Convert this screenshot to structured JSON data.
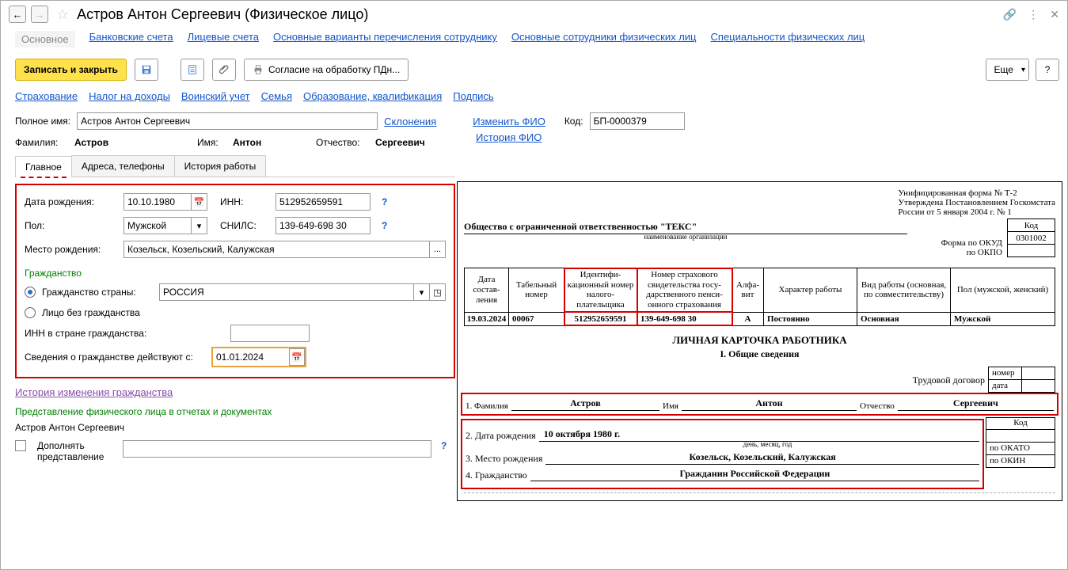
{
  "title": "Астров Антон Сергеевич (Физическое лицо)",
  "nav": {
    "main": "Основное",
    "bank": "Банковские счета",
    "personal": "Лицевые счета",
    "transfer": "Основные варианты перечисления сотруднику",
    "employees": "Основные сотрудники физических лиц",
    "spec": "Специальности физических лиц"
  },
  "toolbar": {
    "save_close": "Записать и закрыть",
    "consent": "Согласие на обработку ПДн...",
    "more": "Еще"
  },
  "sublinks": {
    "insurance": "Страхование",
    "tax": "Налог на доходы",
    "military": "Воинский учет",
    "family": "Семья",
    "edu": "Образование, квалификация",
    "sign": "Подпись"
  },
  "fio": {
    "full_label": "Полное имя:",
    "full_value": "Астров Антон Сергеевич",
    "decl": "Склонения",
    "change": "Изменить ФИО",
    "history": "История ФИО",
    "code_label": "Код:",
    "code_value": "БП-0000379",
    "last_label": "Фамилия:",
    "last": "Астров",
    "first_label": "Имя:",
    "first": "Антон",
    "mid_label": "Отчество:",
    "mid": "Сергеевич"
  },
  "tabs": {
    "main": "Главное",
    "addr": "Адреса, телефоны",
    "work": "История работы"
  },
  "form": {
    "dob_label": "Дата рождения:",
    "dob": "10.10.1980",
    "inn_label": "ИНН:",
    "inn": "512952659591",
    "sex_label": "Пол:",
    "sex": "Мужской",
    "snils_label": "СНИЛС:",
    "snils": "139-649-698 30",
    "pob_label": "Место рождения:",
    "pob": "Козельск, Козельский, Калужская",
    "citizenship_head": "Гражданство",
    "citizenship_country_label": "Гражданство страны:",
    "citizenship_country": "РОССИЯ",
    "stateless_label": "Лицо без гражданства",
    "foreign_inn_label": "ИНН в стране гражданства:",
    "since_label": "Сведения о гражданстве действуют с:",
    "since": "01.01.2024",
    "history_link": "История изменения гражданства",
    "repr_head": "Представление физического лица в отчетах и документах",
    "repr_value": "Астров Антон Сергеевич",
    "suppl_label": "Дополнять представление"
  },
  "doc": {
    "form_line1": "Унифицированная форма № Т-2",
    "form_line2": "Утверждена Постановлением Госкомстата",
    "form_line3": "России от 5 января 2004 г. № 1",
    "kod_head": "Код",
    "okud_label": "Форма по ОКУД",
    "okud": "0301002",
    "okpo_label": "по ОКПО",
    "org": "Общество с ограниченной ответственностью \"ТЕКС\"",
    "org_caption": "наименование организации",
    "headers": {
      "date": "Дата состав-ления",
      "tabno": "Табельный номер",
      "inn": "Идентифи-кационный номер налого-плательщика",
      "snils": "Номер страхового свидетельства госу-дарственного пенси-онного страхования",
      "alpha": "Алфа-вит",
      "nature": "Характер работы",
      "type": "Вид работы (основная, по совместительству)",
      "sex": "Пол (мужской, женский)"
    },
    "row": {
      "date": "19.03.2024",
      "tabno": "00067",
      "inn": "512952659591",
      "snils": "139-649-698 30",
      "alpha": "А",
      "nature": "Постоянно",
      "type": "Основная",
      "sex": "Мужской"
    },
    "card_title": "ЛИЧНАЯ КАРТОЧКА РАБОТНИКА",
    "card_sub": "I. Общие сведения",
    "contract_label": "Трудовой договор",
    "contract_num": "номер",
    "contract_date": "дата",
    "f_last_label": "1. Фамилия",
    "f_last": "Астров",
    "f_first_label": "Имя",
    "f_first": "Антон",
    "f_mid_label": "Отчество",
    "f_mid": "Сергеевич",
    "kod": "Код",
    "dob_label": "2. Дата рождения",
    "dob": "10 октября 1980 г.",
    "dob_caption": "день, месяц, год",
    "pob_label": "3. Место рождения",
    "pob": "Козельск, Козельский, Калужская",
    "okato": "по ОКАТО",
    "cit_label": "4. Гражданство",
    "cit": "Гражданин Российской Федерации",
    "okin": "по ОКИН"
  }
}
